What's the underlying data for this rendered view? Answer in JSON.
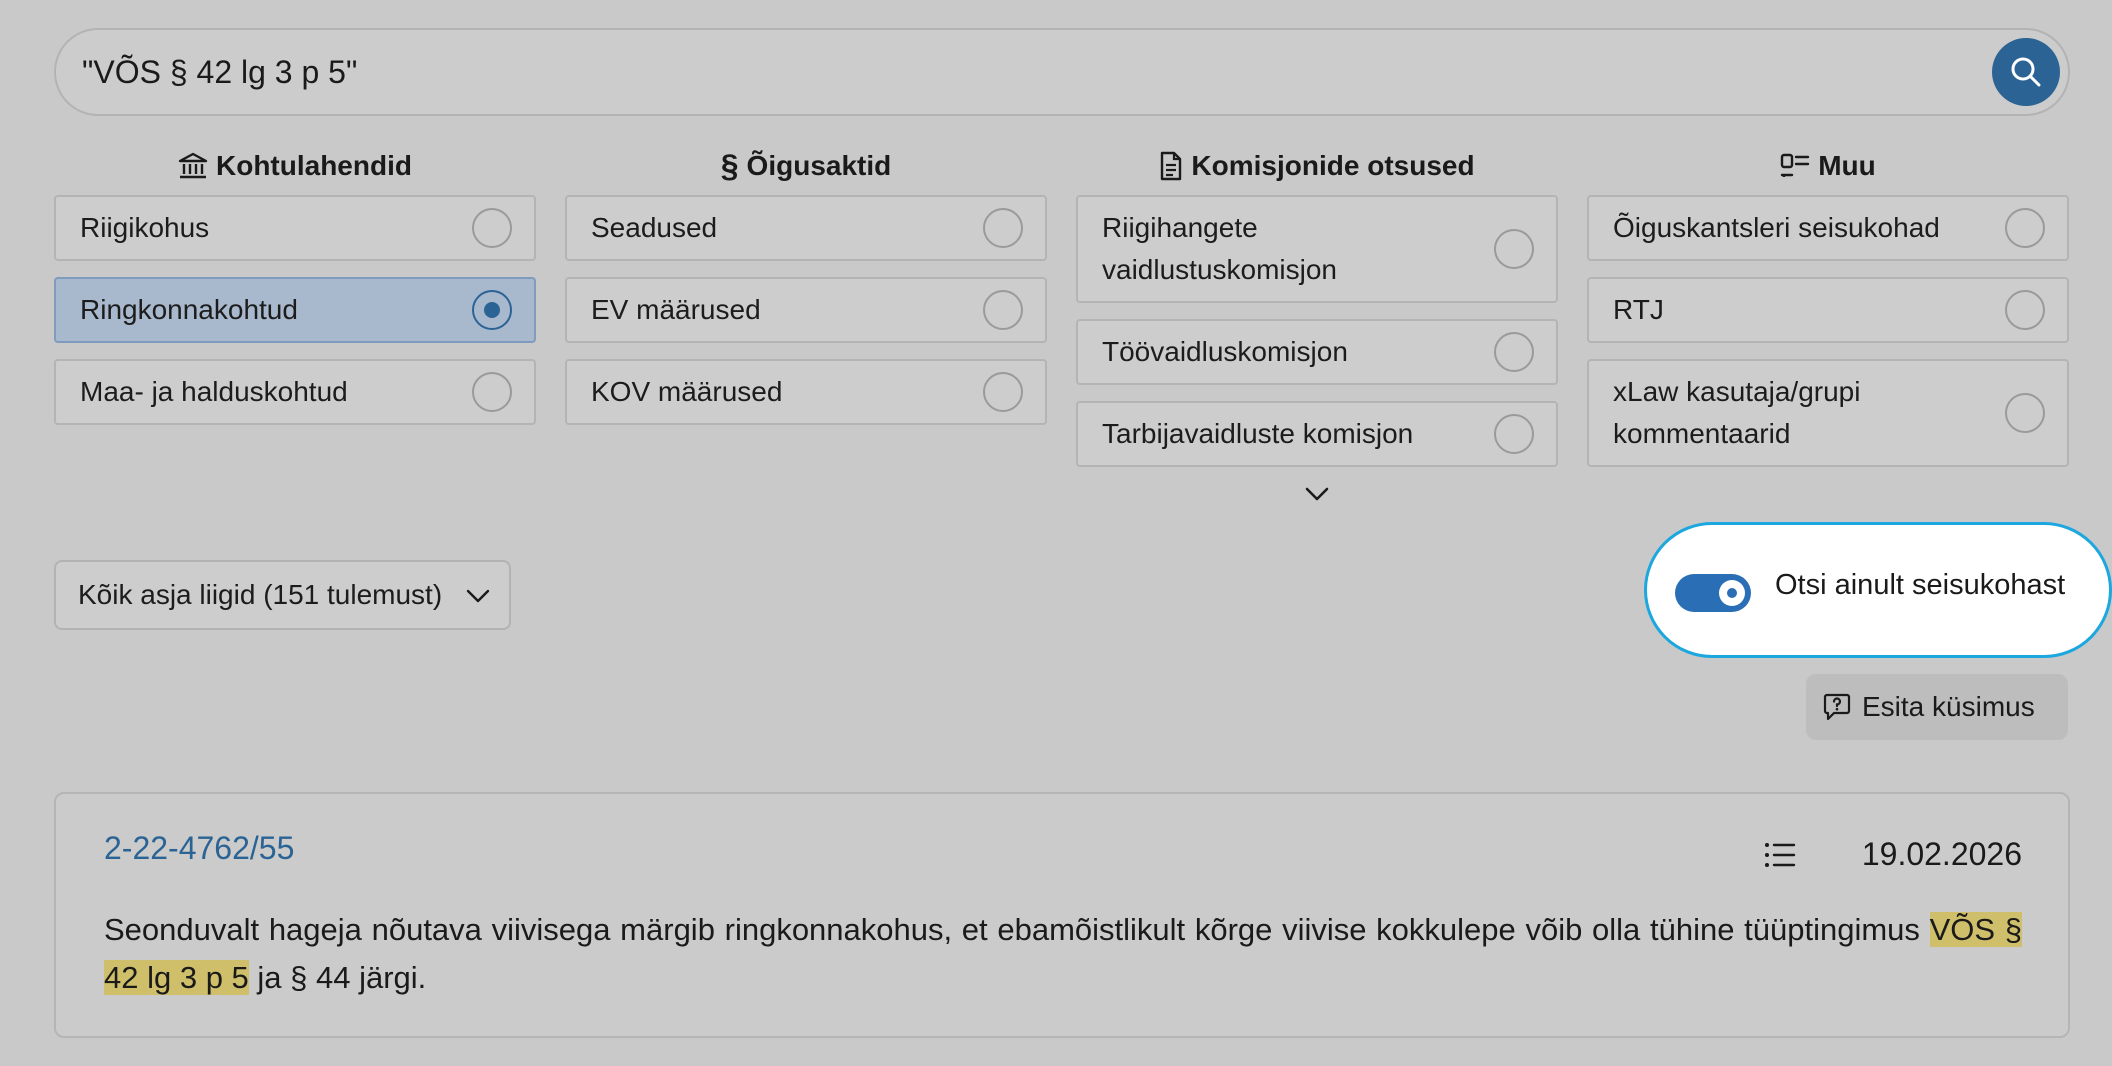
{
  "search": {
    "query": "\"VÕS § 42 lg 3 p 5\""
  },
  "categories": [
    {
      "title": "Kohtulahendid",
      "icon": "courthouse-icon",
      "options": [
        {
          "label": "Riigikohus",
          "selected": false
        },
        {
          "label": "Ringkonnakohtud",
          "selected": true
        },
        {
          "label": "Maa- ja halduskohtud",
          "selected": false
        }
      ]
    },
    {
      "title": "Õigusaktid",
      "icon": "section-sign-icon",
      "options": [
        {
          "label": "Seadused",
          "selected": false
        },
        {
          "label": "EV määrused",
          "selected": false
        },
        {
          "label": "KOV määrused",
          "selected": false
        }
      ]
    },
    {
      "title": "Komisjonide otsused",
      "icon": "document-icon",
      "options": [
        {
          "label": "Riigihangete vaidlustuskomisjon",
          "selected": false
        },
        {
          "label": "Töövaidluskomisjon",
          "selected": false
        },
        {
          "label": "Tarbijavaidluste komisjon",
          "selected": false
        }
      ]
    },
    {
      "title": "Muu",
      "icon": "layout-icon",
      "options": [
        {
          "label": "Õiguskantsleri seisukohad",
          "selected": false
        },
        {
          "label": "RTJ",
          "selected": false
        },
        {
          "label": "xLaw kasutaja/grupi kommentaarid",
          "selected": false
        }
      ]
    }
  ],
  "filter": {
    "case_type_label": "Kõik asja liigid (151 tulemust)"
  },
  "toggle": {
    "label": "Otsi ainult seisukohast",
    "on": true
  },
  "ask_button": {
    "label": "Esita küsimus"
  },
  "result": {
    "case_number": "2-22-4762/55",
    "date": "19.02.2026",
    "snippet_before": "Seonduvalt hageja nõutava viivisega märgib ringkonnakohus, et ebamõistlikult kõrge viivise kokkulepe võib olla tühine tüüptingimus ",
    "snippet_highlight": "VÕS § 42 lg 3 p 5",
    "snippet_after": " ja § 44 järgi."
  },
  "colors": {
    "accent": "#2a6394",
    "toggle": "#2a6fb5",
    "highlight_ring": "#1ca7df",
    "selected_bg": "#a8b8cd",
    "text_highlight": "#cfbf6a"
  }
}
